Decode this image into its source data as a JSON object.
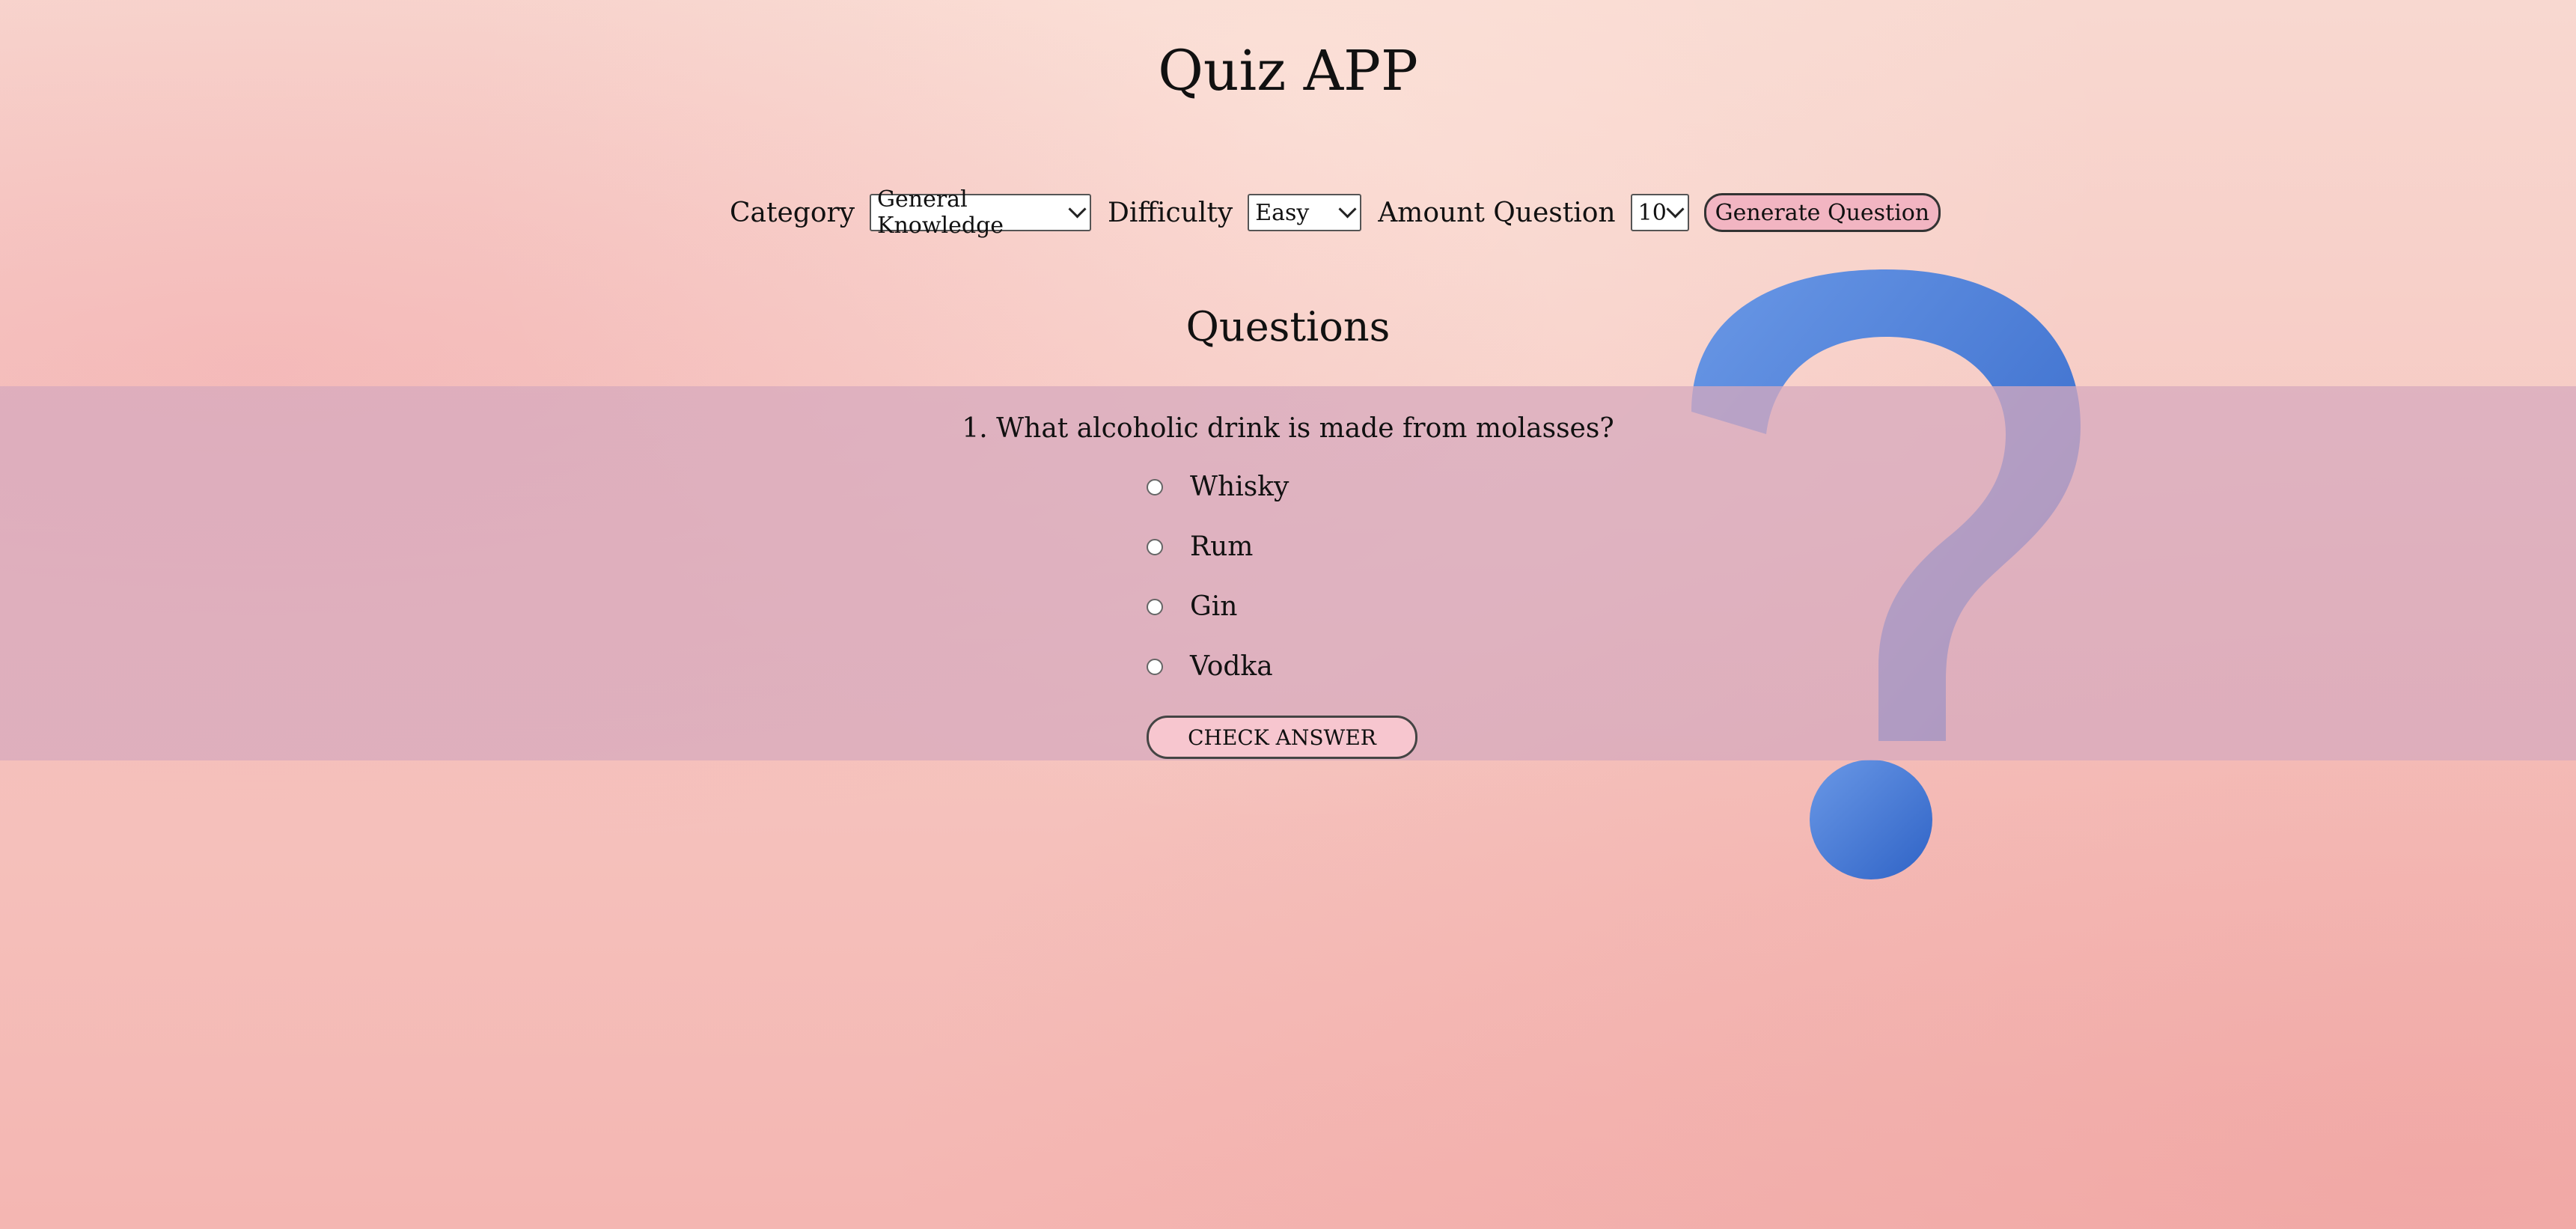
{
  "app": {
    "title": "Quiz APP"
  },
  "controls": {
    "category_label": "Category",
    "category_value": "General Knowledge",
    "difficulty_label": "Difficulty",
    "difficulty_value": "Easy",
    "amount_label": "Amount Question",
    "amount_value": "10",
    "generate_label": "Generate Question"
  },
  "questions": {
    "heading": "Questions",
    "items": [
      {
        "text": "1. What alcoholic drink is made from molasses?",
        "options": [
          "Whisky",
          "Rum",
          "Gin",
          "Vodka"
        ],
        "check_label": "CHECK ANSWER"
      }
    ]
  },
  "colors": {
    "background": "#f6c8c2",
    "band": "#d7aabe",
    "button_fill": "#f2b5c2",
    "question_mark": "#4a7fd6"
  },
  "icons": [
    "question-mark-decor-icon",
    "chevron-down-icon"
  ]
}
